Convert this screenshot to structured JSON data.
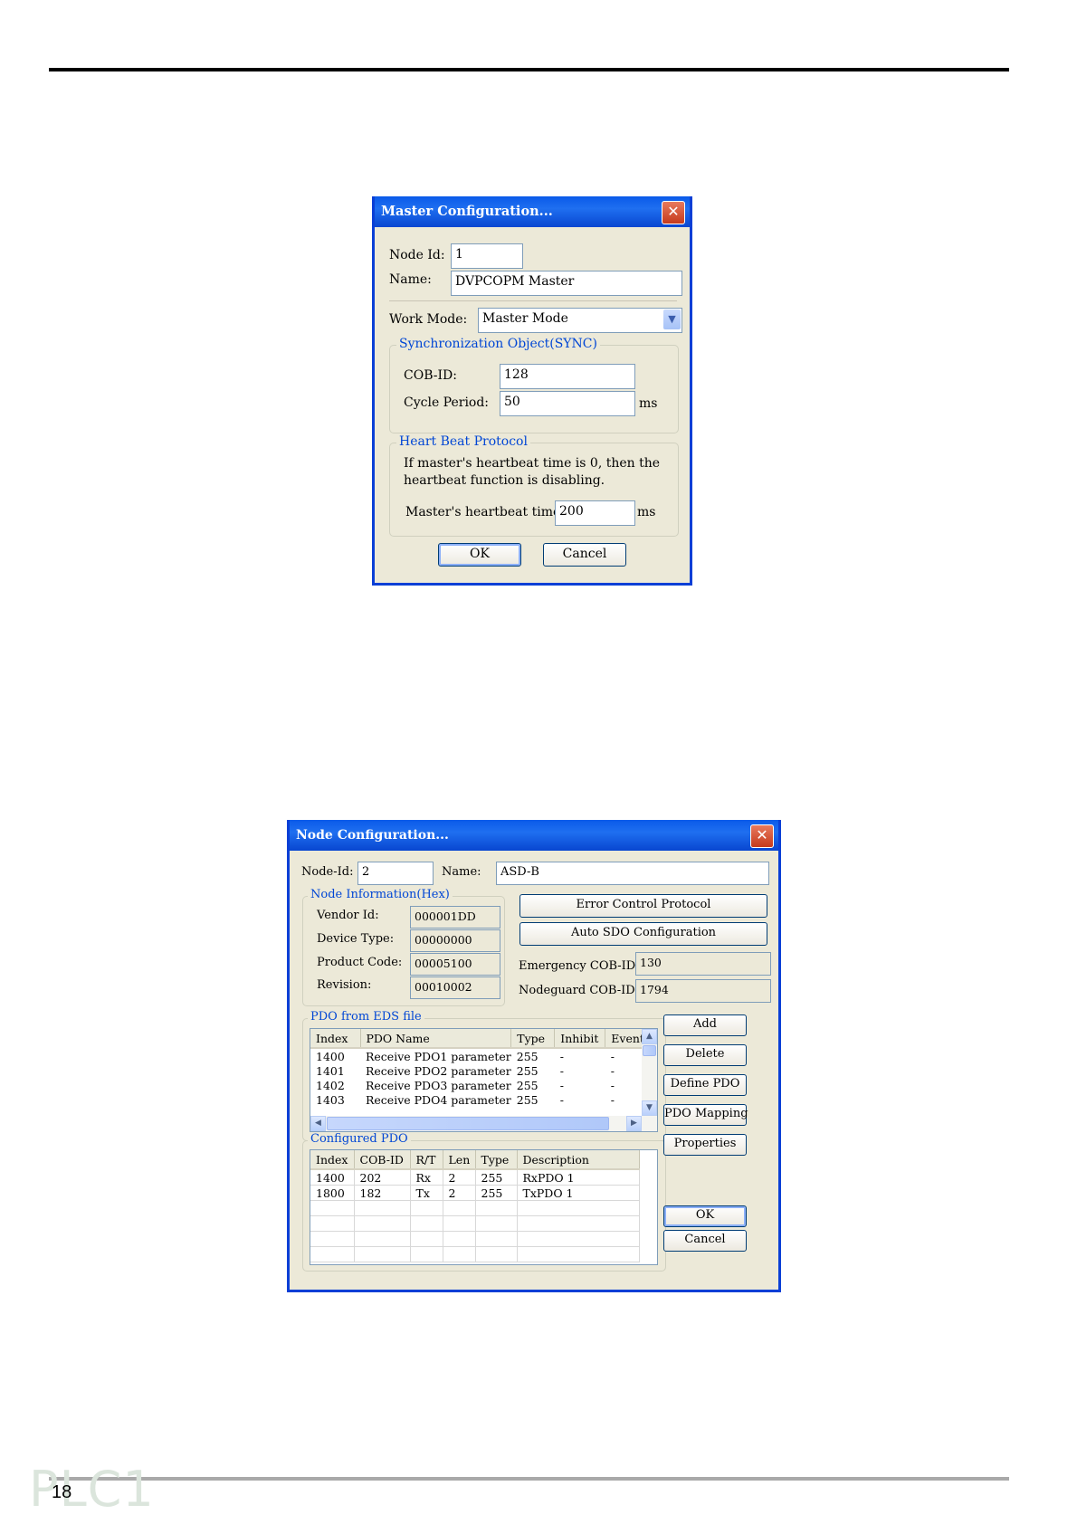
{
  "page": {
    "number": "18",
    "logo_text": "PLC1"
  },
  "master_dialog": {
    "title": "Master Configuration...",
    "close_glyph": "✕",
    "node_id_label": "Node Id:",
    "node_id_value": "1",
    "name_label": "Name:",
    "name_value": "DVPCOPM Master",
    "work_mode_label": "Work Mode:",
    "work_mode_value": "Master Mode",
    "sync_group": {
      "title": "Synchronization Object(SYNC)",
      "cob_id_label": "COB-ID:",
      "cob_id_value": "128",
      "cycle_period_label": "Cycle Period:",
      "cycle_period_value": "50",
      "cycle_unit": "ms"
    },
    "heartbeat_group": {
      "title": "Heart Beat Protocol",
      "note_line1": "If master's heartbeat time is 0, then the",
      "note_line2": "heartbeat function is disabling.",
      "time_label": "Master's heartbeat time:",
      "time_value": "200",
      "time_unit": "ms"
    },
    "ok_label": "OK",
    "cancel_label": "Cancel"
  },
  "node_dialog": {
    "title": "Node Configuration...",
    "close_glyph": "✕",
    "node_id_label": "Node-Id:",
    "node_id_value": "2",
    "name_label": "Name:",
    "name_value": "ASD-B",
    "node_info": {
      "title": "Node Information(Hex)",
      "vendor_id_label": "Vendor Id:",
      "vendor_id_value": "000001DD",
      "device_type_label": "Device Type:",
      "device_type_value": "00000000",
      "product_code_label": "Product Code:",
      "product_code_value": "00005100",
      "revision_label": "Revision:",
      "revision_value": "00010002"
    },
    "error_control_label": "Error Control Protocol",
    "auto_sdo_label": "Auto SDO Configuration",
    "emergency_label": "Emergency COB-ID:",
    "emergency_value": "130",
    "nodeguard_label": "Nodeguard COB-ID:",
    "nodeguard_value": "1794",
    "pdo_eds": {
      "title": "PDO from EDS file",
      "columns": [
        "Index",
        "PDO Name",
        "Type",
        "Inhibit",
        "Event"
      ],
      "rows": [
        [
          "1400",
          "Receive PDO1 parameter",
          "255",
          "-",
          "-"
        ],
        [
          "1401",
          "Receive PDO2 parameter",
          "255",
          "-",
          "-"
        ],
        [
          "1402",
          "Receive PDO3 parameter",
          "255",
          "-",
          "-"
        ],
        [
          "1403",
          "Receive PDO4 parameter",
          "255",
          "-",
          "-"
        ]
      ]
    },
    "configured_pdo": {
      "title": "Configured PDO",
      "columns": [
        "Index",
        "COB-ID",
        "R/T",
        "Len",
        "Type",
        "Description"
      ],
      "rows": [
        [
          "1400",
          "202",
          "Rx",
          "2",
          "255",
          "RxPDO 1"
        ],
        [
          "1800",
          "182",
          "Tx",
          "2",
          "255",
          "TxPDO 1"
        ]
      ]
    },
    "add_label": "Add",
    "delete_label": "Delete",
    "define_pdo_label": "Define PDO",
    "pdo_mapping_label": "PDO Mapping",
    "properties_label": "Properties",
    "ok_label": "OK",
    "cancel_label": "Cancel"
  }
}
